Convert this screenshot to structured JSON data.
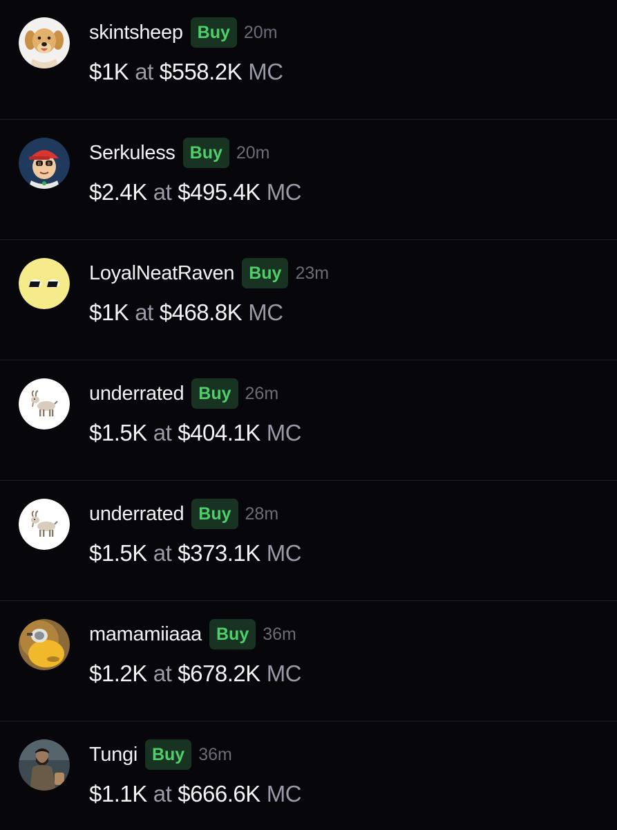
{
  "trades": [
    {
      "user": "skintsheep",
      "badge": "Buy",
      "time": "20m",
      "amount": "$1K",
      "at": "at",
      "mc": "$558.2K",
      "unit": "MC",
      "avatar_icon": "golden-retriever-puppy-avatar"
    },
    {
      "user": "Serkuless",
      "badge": "Buy",
      "time": "20m",
      "amount": "$2.4K",
      "at": "at",
      "mc": "$495.4K",
      "unit": "MC",
      "avatar_icon": "cartoon-cap-character-avatar"
    },
    {
      "user": "LoyalNeatRaven",
      "badge": "Buy",
      "time": "23m",
      "amount": "$1K",
      "at": "at",
      "mc": "$468.8K",
      "unit": "MC",
      "avatar_icon": "yellow-eyes-avatar"
    },
    {
      "user": "underrated",
      "badge": "Buy",
      "time": "26m",
      "amount": "$1.5K",
      "at": "at",
      "mc": "$404.1K",
      "unit": "MC",
      "avatar_icon": "goat-avatar"
    },
    {
      "user": "underrated",
      "badge": "Buy",
      "time": "28m",
      "amount": "$1.5K",
      "at": "at",
      "mc": "$373.1K",
      "unit": "MC",
      "avatar_icon": "goat-avatar"
    },
    {
      "user": "mamamiiaaa",
      "badge": "Buy",
      "time": "36m",
      "amount": "$1.2K",
      "at": "at",
      "mc": "$678.2K",
      "unit": "MC",
      "avatar_icon": "goggles-creature-avatar"
    },
    {
      "user": "Tungi",
      "badge": "Buy",
      "time": "36m",
      "amount": "$1.1K",
      "at": "at",
      "mc": "$666.6K",
      "unit": "MC",
      "avatar_icon": "bearded-man-photo-avatar"
    }
  ],
  "colors": {
    "background": "#06060b",
    "divider": "#1e1e26",
    "buy_badge_bg": "#183322",
    "buy_badge_text": "#4fcf6a",
    "muted_text": "#9a9aa6",
    "time_text": "#6c6c78"
  }
}
